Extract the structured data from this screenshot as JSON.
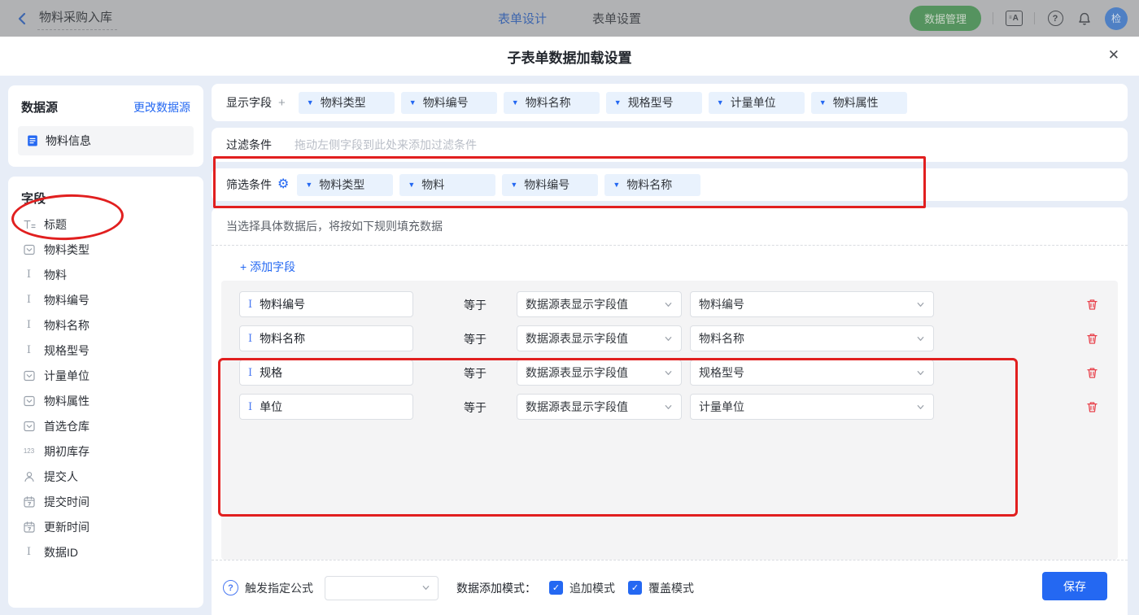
{
  "topbar": {
    "back_title": "物料采购入库",
    "tabs": [
      {
        "label": "表单设计",
        "active": true
      },
      {
        "label": "表单设置",
        "active": false
      }
    ],
    "data_manage_label": "数据管理",
    "translate_icon_letter": "A",
    "avatar_text": "检"
  },
  "modal": {
    "title": "子表单数据加载设置",
    "close_glyph": "✕"
  },
  "sidebar": {
    "datasource_title": "数据源",
    "change_datasource_link": "更改数据源",
    "datasource_item": "物料信息",
    "fields_title": "字段",
    "fields": [
      {
        "icon": "title-field-icon",
        "type": "title",
        "label": "标题"
      },
      {
        "icon": "select-field-icon",
        "type": "select",
        "label": "物料类型"
      },
      {
        "icon": "text-field-icon",
        "type": "text",
        "label": "物料"
      },
      {
        "icon": "text-field-icon",
        "type": "text",
        "label": "物料编号"
      },
      {
        "icon": "text-field-icon",
        "type": "text",
        "label": "物料名称"
      },
      {
        "icon": "text-field-icon",
        "type": "text",
        "label": "规格型号"
      },
      {
        "icon": "select-field-icon",
        "type": "select",
        "label": "计量单位"
      },
      {
        "icon": "select-field-icon",
        "type": "select",
        "label": "物料属性"
      },
      {
        "icon": "select-field-icon",
        "type": "select",
        "label": "首选仓库"
      },
      {
        "icon": "number-field-icon",
        "type": "number",
        "label": "期初库存"
      },
      {
        "icon": "person-field-icon",
        "type": "person",
        "label": "提交人"
      },
      {
        "icon": "date-field-icon",
        "type": "date",
        "label": "提交时间"
      },
      {
        "icon": "date-field-icon",
        "type": "date",
        "label": "更新时间"
      },
      {
        "icon": "text-field-icon",
        "type": "text",
        "label": "数据ID"
      }
    ]
  },
  "main": {
    "display_fields": {
      "label": "显示字段",
      "add_glyph": "+",
      "tags": [
        "物料类型",
        "物料编号",
        "物料名称",
        "规格型号",
        "计量单位",
        "物料属性"
      ]
    },
    "filter": {
      "label": "过滤条件",
      "placeholder": "拖动左侧字段到此处来添加过滤条件"
    },
    "sift": {
      "label": "筛选条件",
      "gear_glyph": "⚙",
      "tags": [
        "物料类型",
        "物料",
        "物料编号",
        "物料名称"
      ]
    },
    "rule_hint": "当选择具体数据后，将按如下规则填充数据",
    "add_field_link": "+ 添加字段",
    "rules": [
      {
        "field": "物料编号",
        "op": "等于",
        "source": "数据源表显示字段值",
        "value": "物料编号"
      },
      {
        "field": "物料名称",
        "op": "等于",
        "source": "数据源表显示字段值",
        "value": "物料名称"
      },
      {
        "field": "规格",
        "op": "等于",
        "source": "数据源表显示字段值",
        "value": "规格型号"
      },
      {
        "field": "单位",
        "op": "等于",
        "source": "数据源表显示字段值",
        "value": "计量单位"
      }
    ],
    "footer": {
      "formula_label": "触发指定公式",
      "formula_value": "",
      "mode_label": "数据添加模式：",
      "modes": [
        {
          "label": "追加模式",
          "checked": true
        },
        {
          "label": "覆盖模式",
          "checked": true
        }
      ],
      "save_label": "保存"
    }
  },
  "colors": {
    "accent_blue": "#2468f2",
    "annotation_red": "#e11f1f",
    "trash_red": "#e8434d",
    "tag_bg": "#e9f2fd",
    "panel_gray": "#f4f4f5",
    "page_bg": "#e7edf7",
    "topbar_dimmed": "#b1b2b4",
    "green_button": "#55935f"
  }
}
